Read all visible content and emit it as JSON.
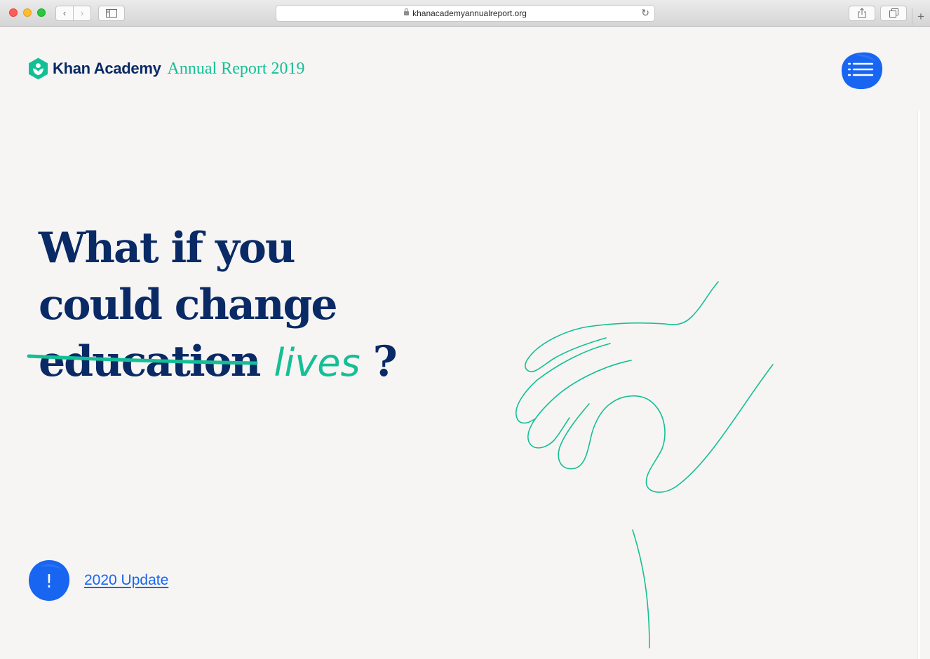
{
  "browser": {
    "url": "khanacademyannualreport.org",
    "back_glyph": "‹",
    "forward_glyph": "›",
    "reload_glyph": "↻",
    "new_tab_glyph": "+",
    "icons": [
      "back-icon",
      "forward-icon",
      "sidebar-icon",
      "lock-icon",
      "reload-icon",
      "share-icon",
      "tabs-icon",
      "new-tab-icon"
    ]
  },
  "header": {
    "brand_name": "Khan Academy",
    "report_title": "Annual Report 2019",
    "menu_icon": "hamburger-list-icon"
  },
  "hero": {
    "line1": "What if you",
    "line2": "could change",
    "struck_word": "education",
    "replacement_word": "lives",
    "question_mark": "?"
  },
  "update": {
    "badge_glyph": "!",
    "link_label": "2020 Update"
  },
  "colors": {
    "background": "#f6f5f3",
    "navy": "#0a2a66",
    "green": "#14bf96",
    "blue": "#1865f2"
  }
}
